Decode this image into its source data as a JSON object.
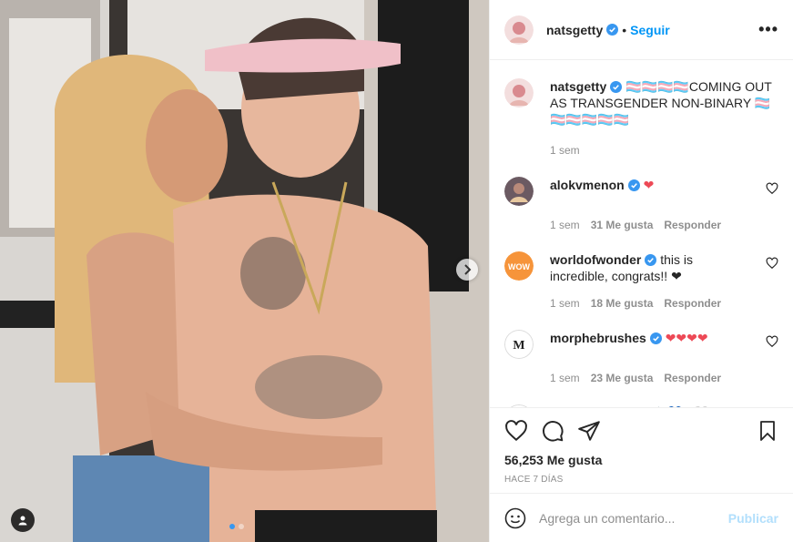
{
  "post": {
    "username": "natsgetty",
    "follow_label": "Seguir",
    "more_label": "•••",
    "caption": "🏳️‍⚧️🏳️‍⚧️🏳️‍⚧️🏳️‍⚧️COMING OUT AS TRANSGENDER NON-BINARY 🏳️‍⚧️🏳️‍⚧️🏳️‍⚧️🏳️‍⚧️🏳️‍⚧️🏳️‍⚧️",
    "caption_time": "1 sem"
  },
  "comments": [
    {
      "user": "alokvmenon",
      "text": "❤",
      "time": "1 sem",
      "likes": "31 Me gusta",
      "reply": "Responder"
    },
    {
      "user": "worldofwonder",
      "text": "this is incredible, congrats!! ❤",
      "time": "1 sem",
      "likes": "18 Me gusta",
      "reply": "Responder"
    },
    {
      "user": "morphebrushes",
      "text": "❤❤❤❤",
      "time": "1 sem",
      "likes": "23 Me gusta",
      "reply": "Responder"
    },
    {
      "user": "amberscloset",
      "text": "🙌🏾💙❤🤍❤",
      "time": "",
      "likes": "",
      "reply": ""
    }
  ],
  "actions": {
    "likes_count": "56,253 Me gusta",
    "date": "HACE 7 DÍAS"
  },
  "add_comment": {
    "placeholder": "Agrega un comentario...",
    "publish": "Publicar"
  },
  "icons": [
    "heart-icon",
    "comment-icon",
    "share-icon",
    "bookmark-icon",
    "emoji-icon",
    "tag-user-icon",
    "verified-icon"
  ],
  "colors": {
    "accent": "#0095f6",
    "verified": "#3897f0",
    "like": "#ed4956",
    "muted": "#8e8e8e"
  }
}
